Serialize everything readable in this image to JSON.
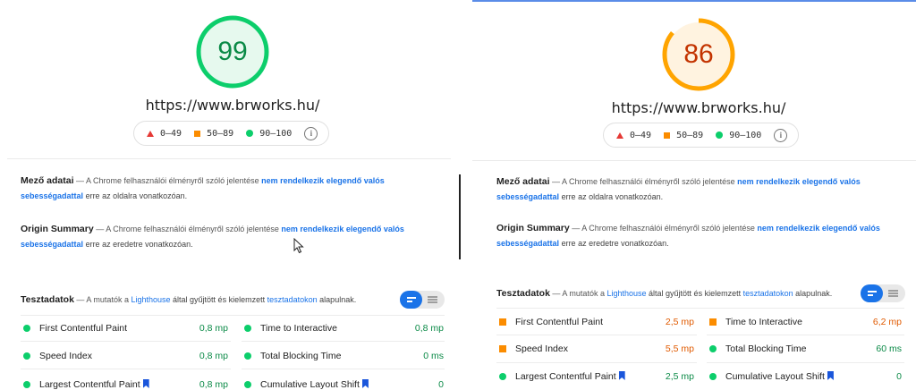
{
  "left": {
    "score": "99",
    "url": "https://www.brworks.hu/",
    "colors": {
      "ring": "#0cce6b",
      "fill": "#e6f9ee",
      "text": "#0a8a46"
    },
    "legend": [
      "0–49",
      "50–89",
      "90–100"
    ],
    "field": {
      "title": "Mező adatai",
      "desc": "— A Chrome felhasználói élményről szóló jelentése",
      "link": "nem rendelkezik elegendő valós sebességadattal",
      "tail": "erre az oldalra vonatkozóan."
    },
    "origin": {
      "title": "Origin Summary",
      "desc": "— A Chrome felhasználói élményről szóló jelentése",
      "link": "nem rendelkezik elegendő valós sebességadattal",
      "tail": "erre az eredetre vonatkozóan."
    },
    "lab": {
      "title": "Tesztadatok",
      "desc": "— A mutatók a",
      "link1": "Lighthouse",
      "mid": "által gyűjtött és kielemzett",
      "link2": "tesztadatokon",
      "tail": "alapulnak."
    },
    "metrics": [
      {
        "label": "First Contentful Paint",
        "value": "0,8 mp",
        "status": "green"
      },
      {
        "label": "Time to Interactive",
        "value": "0,8 mp",
        "status": "green"
      },
      {
        "label": "Speed Index",
        "value": "0,8 mp",
        "status": "green"
      },
      {
        "label": "Total Blocking Time",
        "value": "0 ms",
        "status": "green"
      },
      {
        "label": "Largest Contentful Paint",
        "value": "0,8 mp",
        "status": "green"
      },
      {
        "label": "Cumulative Layout Shift",
        "value": "0",
        "status": "green"
      }
    ]
  },
  "right": {
    "score": "86",
    "url": "https://www.brworks.hu/",
    "colors": {
      "ring": "#ffa400",
      "fill": "#fff3e0",
      "text": "#c33300"
    },
    "legend": [
      "0–49",
      "50–89",
      "90–100"
    ],
    "field": {
      "title": "Mező adatai",
      "desc": "— A Chrome felhasználói élményről szóló jelentése",
      "link": "nem rendelkezik elegendő valós sebességadattal",
      "tail": "erre az oldalra vonatkozóan."
    },
    "origin": {
      "title": "Origin Summary",
      "desc": "— A Chrome felhasználói élményről szóló jelentése",
      "link": "nem rendelkezik elegendő valós sebességadattal",
      "tail": "erre az eredetre vonatkozóan."
    },
    "lab": {
      "title": "Tesztadatok",
      "desc": "— A mutatók a",
      "link1": "Lighthouse",
      "mid": "által gyűjtött és kielemzett",
      "link2": "tesztadatokon",
      "tail": "alapulnak."
    },
    "metrics": [
      {
        "label": "First Contentful Paint",
        "value": "2,5 mp",
        "status": "orange"
      },
      {
        "label": "Time to Interactive",
        "value": "6,2 mp",
        "status": "orange"
      },
      {
        "label": "Speed Index",
        "value": "5,5 mp",
        "status": "orange"
      },
      {
        "label": "Total Blocking Time",
        "value": "60 ms",
        "status": "green"
      },
      {
        "label": "Largest Contentful Paint",
        "value": "2,5 mp",
        "status": "green"
      },
      {
        "label": "Cumulative Layout Shift",
        "value": "0",
        "status": "green"
      }
    ]
  }
}
